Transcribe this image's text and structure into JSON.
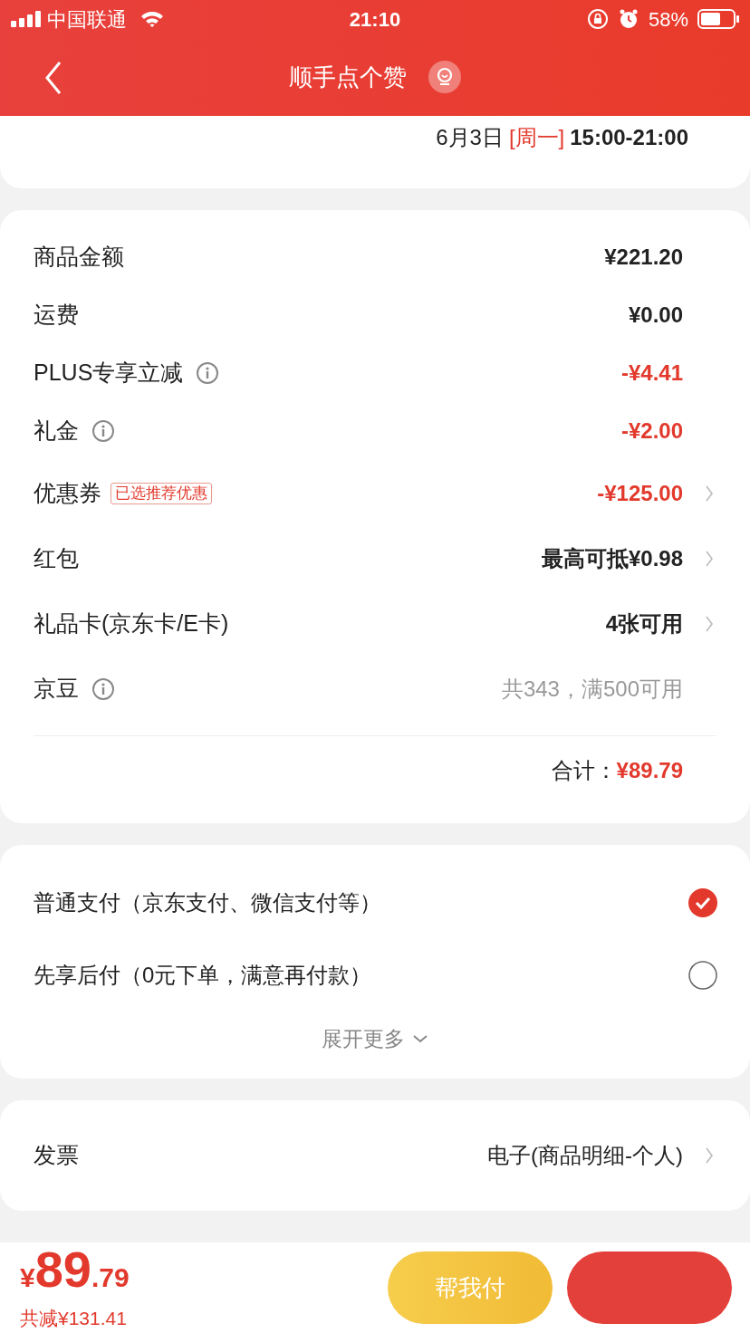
{
  "status_bar": {
    "carrier": "中国联通",
    "time": "21:10",
    "battery": "58%"
  },
  "nav": {
    "title": "顺手点个赞"
  },
  "delivery": {
    "date": "6月3日",
    "weekday": "[周一]",
    "time_range": "15:00-21:00"
  },
  "summary": {
    "rows": [
      {
        "label": "商品金额",
        "value": "¥221.20",
        "kind": "normal",
        "info": false,
        "chevron": false
      },
      {
        "label": "运费",
        "value": "¥0.00",
        "kind": "normal",
        "info": false,
        "chevron": false
      },
      {
        "label": "PLUS专享立减",
        "value": "-¥4.41",
        "kind": "discount",
        "info": true,
        "chevron": false
      },
      {
        "label": "礼金",
        "value": "-¥2.00",
        "kind": "discount",
        "info": true,
        "chevron": false
      },
      {
        "label": "优惠券",
        "tag": "已选推荐优惠",
        "value": "-¥125.00",
        "kind": "discount",
        "info": false,
        "chevron": true
      },
      {
        "label": "红包",
        "value": "最高可抵¥0.98",
        "kind": "normal",
        "info": false,
        "chevron": true
      },
      {
        "label": "礼品卡(京东卡/E卡)",
        "value": "4张可用",
        "kind": "normal",
        "info": false,
        "chevron": true
      },
      {
        "label": "京豆",
        "value": "共343，满500可用",
        "kind": "muted",
        "info": true,
        "chevron": false
      }
    ],
    "total_label": "合计：",
    "total_value": "¥89.79"
  },
  "payment": {
    "options": [
      {
        "label": "普通支付（京东支付、微信支付等）",
        "selected": true
      },
      {
        "label": "先享后付（0元下单，满意再付款）",
        "selected": false
      }
    ],
    "more": "展开更多"
  },
  "invoice": {
    "label": "发票",
    "value": "电子(商品明细-个人)"
  },
  "bottom": {
    "price": {
      "currency": "¥",
      "integer": "89",
      "decimal": ".79"
    },
    "saved": "共减¥131.41",
    "help_button": "帮我付"
  }
}
